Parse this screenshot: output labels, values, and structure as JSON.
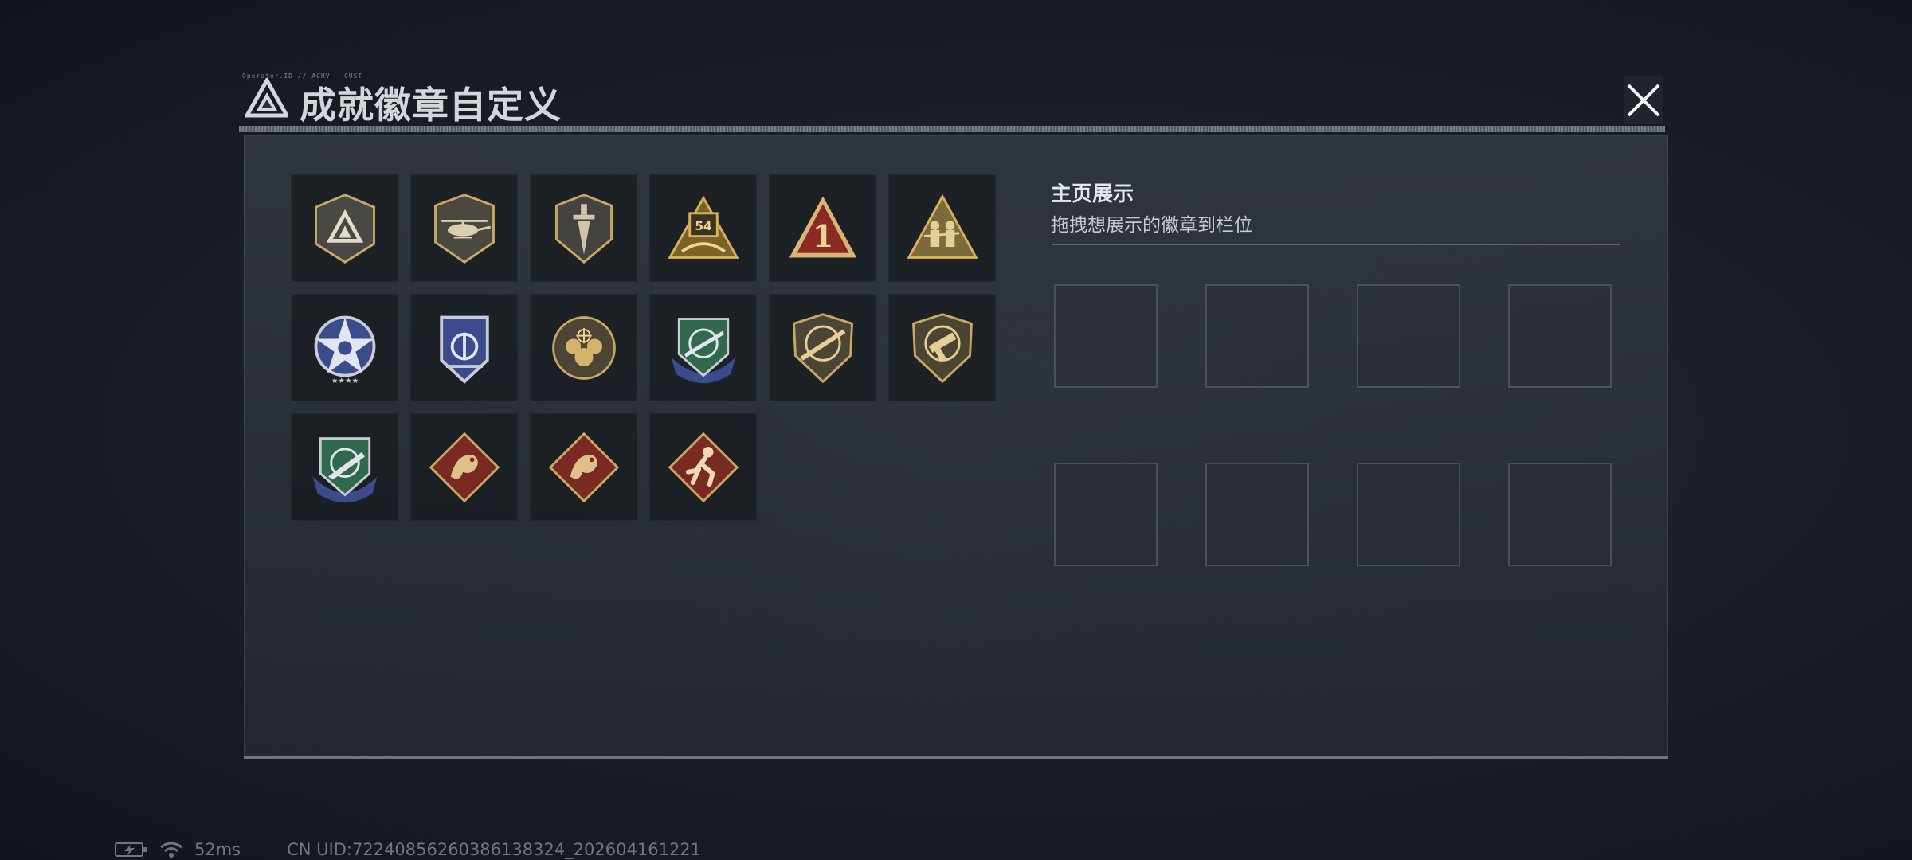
{
  "window": {
    "title": "成就徽章自定义",
    "tag": "Operator.ID  //  ACHV · CUST"
  },
  "colors": {
    "accent": "#d3d6da",
    "gold": "#c9a962",
    "badge_red": "#7a2a22",
    "badge_blue": "#3a4c8c",
    "badge_green": "#2f6a4d"
  },
  "badges": [
    {
      "icon": "triangle-shield-badge-icon"
    },
    {
      "icon": "helicopter-shield-badge-icon"
    },
    {
      "icon": "dagger-shield-badge-icon"
    },
    {
      "icon": "rank-54-badge-icon",
      "number": "54"
    },
    {
      "icon": "red-triangle-1-badge-icon",
      "number": "1"
    },
    {
      "icon": "soldiers-triangle-badge-icon"
    },
    {
      "icon": "silver-star-badge-icon"
    },
    {
      "icon": "blue-shield-badge-icon"
    },
    {
      "icon": "gold-crosshair-round-badge-icon"
    },
    {
      "icon": "green-blue-crest-rifle-badge-icon"
    },
    {
      "icon": "gold-rifle-shield-badge-icon"
    },
    {
      "icon": "gold-pistol-shield-badge-icon"
    },
    {
      "icon": "green-blue-crest-knife-badge-icon"
    },
    {
      "icon": "red-dragon-diamond-badge-icon"
    },
    {
      "icon": "red-dragon-diamond-badge-icon"
    },
    {
      "icon": "red-runner-diamond-badge-icon"
    }
  ],
  "display": {
    "title": "主页展示",
    "subtitle": "拖拽想展示的徽章到栏位",
    "slot_count": 8
  },
  "status": {
    "battery_icon": "battery-charging-icon",
    "wifi_icon": "wifi-icon",
    "ping": "52ms",
    "uid": "CN UID:72240856260386138324_202604161221"
  }
}
